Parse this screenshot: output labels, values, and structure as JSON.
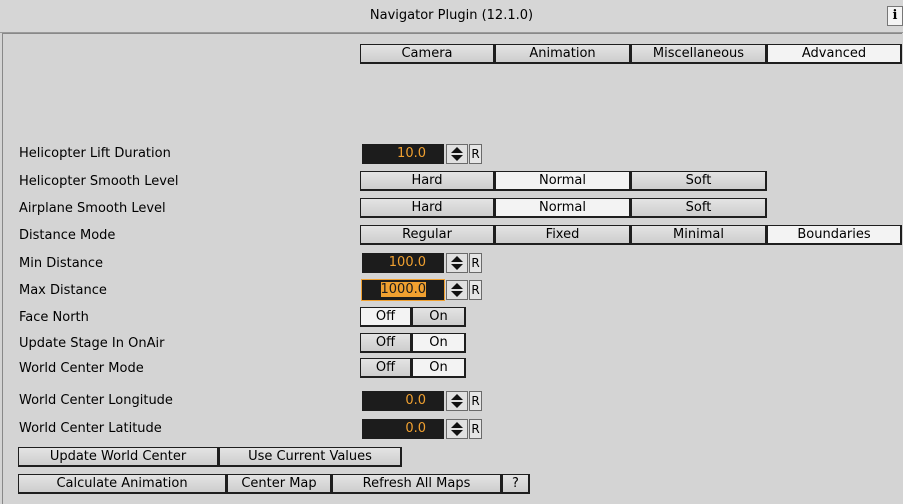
{
  "window": {
    "title": "Navigator Plugin (12.1.0)",
    "info_glyph": "i"
  },
  "tabs": [
    "Camera",
    "Animation",
    "Miscellaneous",
    "Advanced"
  ],
  "rows": {
    "heli_lift": {
      "label": "Helicopter Lift Duration",
      "value": "10.0",
      "reset": "R"
    },
    "heli_smooth": {
      "label": "Helicopter Smooth Level",
      "options": [
        "Hard",
        "Normal",
        "Soft"
      ],
      "selected": "Normal"
    },
    "air_smooth": {
      "label": "Airplane Smooth Level",
      "options": [
        "Hard",
        "Normal",
        "Soft"
      ],
      "selected": "Normal"
    },
    "distance_mode": {
      "label": "Distance Mode",
      "options": [
        "Regular",
        "Fixed",
        "Minimal",
        "Boundaries"
      ],
      "selected": "Boundaries"
    },
    "min_dist": {
      "label": "Min Distance",
      "value": "100.0",
      "reset": "R"
    },
    "max_dist": {
      "label": "Max Distance",
      "value_cursor": "1",
      "value_rest": "000.0",
      "reset": "R"
    },
    "face_north": {
      "label": "Face North",
      "off": "Off",
      "on": "On",
      "selected": "Off"
    },
    "update_stage": {
      "label": "Update Stage In OnAir",
      "off": "Off",
      "on": "On",
      "selected": "On"
    },
    "wc_mode": {
      "label": "World Center Mode",
      "off": "Off",
      "on": "On",
      "selected": "On"
    },
    "wc_lon": {
      "label": "World Center Longitude",
      "value": "0.0",
      "reset": "R"
    },
    "wc_lat": {
      "label": "World Center Latitude",
      "value": "0.0",
      "reset": "R"
    }
  },
  "actions": {
    "update_world_center": "Update World Center",
    "use_current_values": "Use Current Values",
    "calculate_animation": "Calculate  Animation",
    "center_map": "Center Map",
    "refresh_all_maps": "Refresh All Maps",
    "help": "?"
  }
}
